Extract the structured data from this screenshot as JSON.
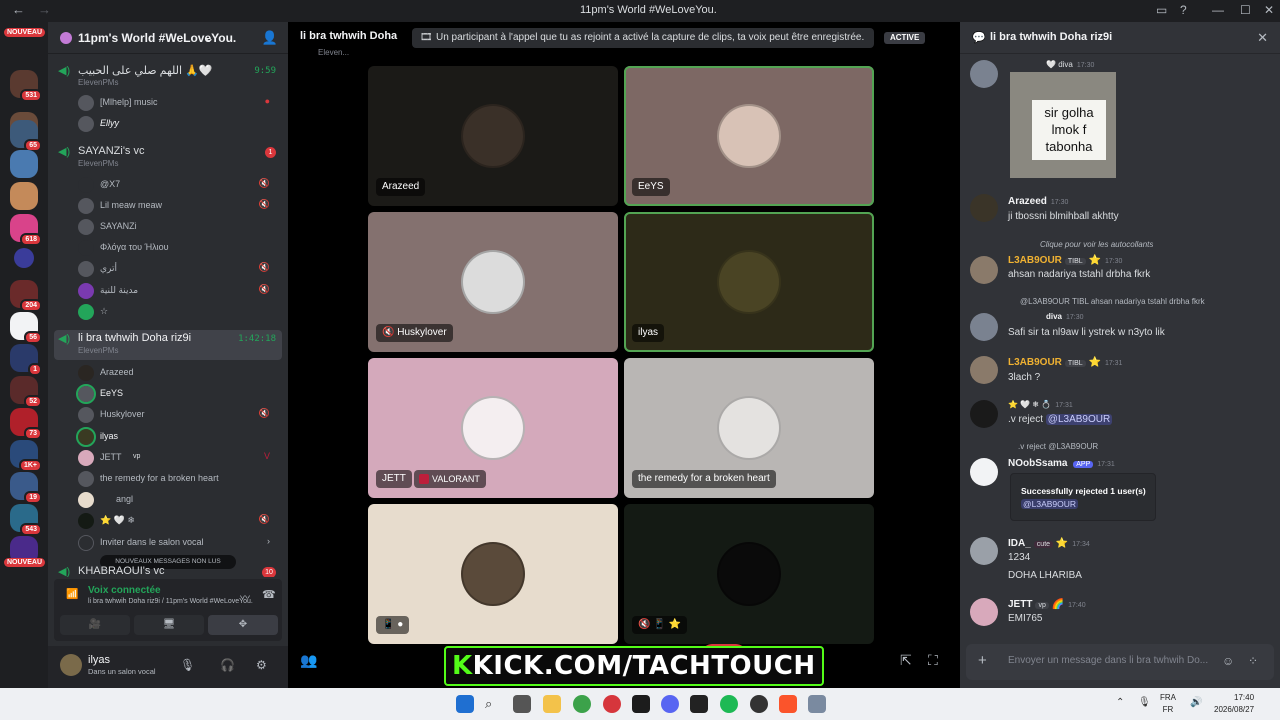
{
  "window": {
    "title": "11pm's World #WeLoveYou."
  },
  "rail": {
    "nouveau_top": "NOUVEAU",
    "nouveau_bottom": "NOUVEAU",
    "badges": [
      "531",
      "65",
      "618",
      "204",
      "56",
      "1",
      "52",
      "73",
      "1K+",
      "19",
      "543"
    ]
  },
  "guild": {
    "name": "11pm's World #WeLoveYou."
  },
  "channels": [
    {
      "name": "اللهم صلي على الحبيب 🙏🤍",
      "sub": "ElevenPMs",
      "time": "9:59",
      "users": [
        {
          "name": "[Mlhelp] music"
        },
        {
          "name": "Ellyy"
        }
      ]
    },
    {
      "name": "SAYANZi's vc",
      "sub": "ElevenPMs",
      "badge": "1",
      "users": [
        {
          "name": "@X7"
        },
        {
          "name": "Lil meaw meaw",
          "tag": "MLBB"
        },
        {
          "name": "SAYANZi"
        },
        {
          "name": "Φλόγα του Ήλιου"
        },
        {
          "name": "أتري"
        },
        {
          "name": "مدينة للنية"
        },
        {
          "name": "☆"
        }
      ]
    },
    {
      "name": "li bra twhwih Doha riz9i",
      "sub": "ElevenPMs",
      "time": "1:42:18",
      "users": [
        {
          "name": "Arazeed"
        },
        {
          "name": "EeYS"
        },
        {
          "name": "Huskylover"
        },
        {
          "name": "ilyas"
        },
        {
          "name": "JETT",
          "tag": "vp"
        },
        {
          "name": "the remedy for a broken heart"
        },
        {
          "name": "angl"
        },
        {
          "name": "⭐ 🤍 ❄"
        },
        {
          "name": "Inviter dans le salon vocal"
        }
      ]
    },
    {
      "name": "KHABRAOUI's vc",
      "badge": "10"
    }
  ],
  "new_messages": "NOUVEAUX MESSAGES NON LUS",
  "voice": {
    "status": "Voix connectée",
    "location": "li bra twhwih Doha riz9i / 11pm's World #WeLoveYou."
  },
  "user": {
    "name": "ilyas",
    "status": "Dans un salon vocal"
  },
  "call": {
    "channel": "li bra twhwih Doha",
    "subtitle": "Eleven...",
    "notice": "Un participant à l'appel que tu as rejoint a activé la capture de clips, ta voix peut être enregistrée.",
    "active": "ACTIVE",
    "tiles": [
      {
        "name": "Arazeed",
        "bg": "#1b1a17"
      },
      {
        "name": "EeYS",
        "bg": "#7d6864"
      },
      {
        "name": "Huskylover",
        "bg": "#84716f"
      },
      {
        "name": "ilyas",
        "bg": "#2d2a18"
      },
      {
        "name": "JETT",
        "bg": "#d4a9bb",
        "activity": "VALORANT"
      },
      {
        "name": "the remedy for a broken heart",
        "bg": "#b9b6b4"
      },
      {
        "name": "",
        "bg": "#e7dccd"
      },
      {
        "name": "",
        "bg": "#141a14"
      }
    ],
    "stream_banner": "KICK.COM/TACHTOUCH"
  },
  "chat": {
    "title": "li bra twhwih Doha riz9i",
    "sign_text": "sir golha lmok f tabonha",
    "messages": [
      {
        "author": "diva",
        "time": "17:30"
      },
      {
        "author": "Arazeed",
        "time": "17:30",
        "text": "ji tbossni blmihball akhtty",
        "color": "#f2f3f5"
      },
      {
        "reply": "Clique pour voir les autocollants",
        "author": "L3AB9OUR",
        "tag": "TIBL",
        "time": "17:30",
        "text": "ahsan nadariya tstahl drbha fkrk",
        "color": "#f0b232"
      },
      {
        "reply": "@L3AB9OUR  TIBL  ahsan nadariya tstahl drbha fkrk",
        "author": "diva",
        "time": "17:30",
        "text": "Safi sir ta nl9aw li ystrek w n3yto lik",
        "color": "#f2f3f5"
      },
      {
        "author": "L3AB9OUR",
        "tag": "TIBL",
        "time": "17:31",
        "text": "3lach ?",
        "color": "#f0b232"
      },
      {
        "author": "⭐ 🤍 ❄",
        "time": "17:31",
        "text": ".v reject",
        "mention": "@L3AB9OUR",
        "color": "#f2f3f5"
      },
      {
        "reply": ".v reject @L3AB9OUR",
        "author": "NOobSsama",
        "tag": "APP",
        "time": "17:31",
        "color": "#f2f3f5"
      },
      {
        "author": "IDA_",
        "tag": "cute",
        "time": "17:34",
        "text": "1234",
        "text2": "DOHA LHARIBA",
        "color": "#f2f3f5"
      },
      {
        "author": "JETT",
        "tag": "vp",
        "time": "17:40",
        "text": "EMI765",
        "color": "#f2f3f5"
      }
    ],
    "embed": {
      "title": "Successfully rejected 1 user(s)",
      "mention": "@L3AB9OUR"
    },
    "input_placeholder": "Envoyer un message dans li bra twhwih Do..."
  },
  "taskbar": {
    "lang1": "FRA",
    "lang2": "FR",
    "time": "17:40",
    "date": "2026/08/27"
  },
  "colors": {
    "speaking": "#53a453",
    "accent": "#5865f2",
    "danger": "#da373c",
    "green": "#23a55a"
  }
}
